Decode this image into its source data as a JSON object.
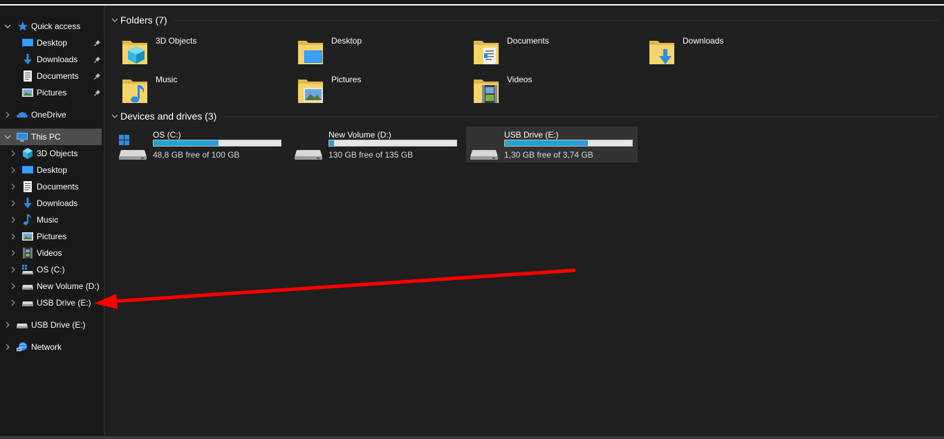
{
  "navigation": {
    "quick_access": {
      "label": "Quick access",
      "items": [
        {
          "label": "Desktop",
          "icon": "desktop-icon",
          "pinned": true
        },
        {
          "label": "Downloads",
          "icon": "downloads-icon",
          "pinned": true
        },
        {
          "label": "Documents",
          "icon": "documents-icon",
          "pinned": true
        },
        {
          "label": "Pictures",
          "icon": "pictures-icon",
          "pinned": true
        }
      ]
    },
    "onedrive": {
      "label": "OneDrive",
      "icon": "onedrive-icon"
    },
    "this_pc": {
      "label": "This PC",
      "icon": "this-pc-icon",
      "selected": true,
      "items": [
        {
          "label": "3D Objects",
          "icon": "3d-objects-icon"
        },
        {
          "label": "Desktop",
          "icon": "desktop-icon"
        },
        {
          "label": "Documents",
          "icon": "documents-icon"
        },
        {
          "label": "Downloads",
          "icon": "downloads-icon"
        },
        {
          "label": "Music",
          "icon": "music-icon"
        },
        {
          "label": "Pictures",
          "icon": "pictures-icon"
        },
        {
          "label": "Videos",
          "icon": "videos-icon"
        },
        {
          "label": "OS (C:)",
          "icon": "os-drive-icon"
        },
        {
          "label": "New Volume (D:)",
          "icon": "drive-icon"
        },
        {
          "label": "USB Drive (E:)",
          "icon": "drive-icon"
        }
      ]
    },
    "usb_drive": {
      "label": "USB Drive (E:)",
      "icon": "drive-icon"
    },
    "network": {
      "label": "Network",
      "icon": "network-icon"
    }
  },
  "content": {
    "folders_header": "Folders (7)",
    "folders": [
      {
        "name": "3D Objects",
        "icon": "3d-objects-folder-icon"
      },
      {
        "name": "Desktop",
        "icon": "desktop-folder-icon"
      },
      {
        "name": "Documents",
        "icon": "documents-folder-icon"
      },
      {
        "name": "Downloads",
        "icon": "downloads-folder-icon"
      },
      {
        "name": "Music",
        "icon": "music-folder-icon"
      },
      {
        "name": "Pictures",
        "icon": "pictures-folder-icon"
      },
      {
        "name": "Videos",
        "icon": "videos-folder-icon"
      }
    ],
    "drives_header": "Devices and drives (3)",
    "drives": [
      {
        "name": "OS (C:)",
        "free_text": "48,8 GB free of 100 GB",
        "used_fraction": 0.512,
        "selected": false
      },
      {
        "name": "New Volume (D:)",
        "free_text": "130 GB free of 135 GB",
        "used_fraction": 0.037,
        "selected": false
      },
      {
        "name": "USB Drive (E:)",
        "free_text": "1,30 GB free of 3,74 GB",
        "used_fraction": 0.652,
        "selected": true
      }
    ]
  },
  "colors": {
    "background": "#191919",
    "content_background": "#202020",
    "selected": "#4d4d4d",
    "capacity_bar": "#26a0da",
    "annotation_arrow": "#ff0000"
  }
}
